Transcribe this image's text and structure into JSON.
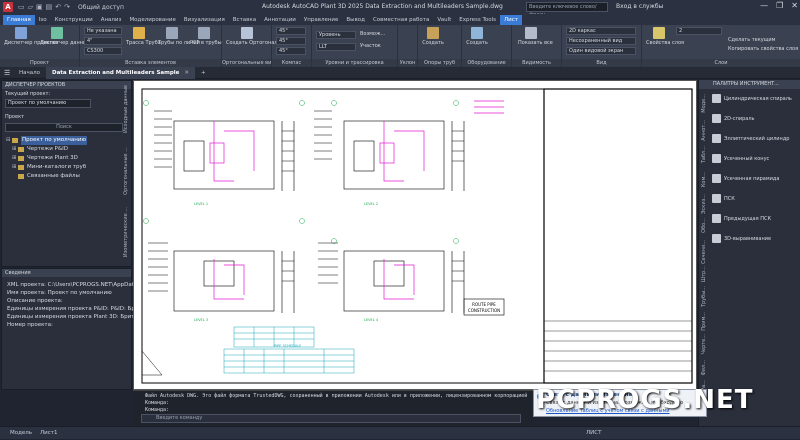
{
  "titlebar": {
    "app_icon": "A",
    "quick_access_icons": [
      "new-icon",
      "open-icon",
      "save-icon",
      "save-as-icon",
      "undo-icon",
      "redo-icon"
    ],
    "share": "Общий доступ",
    "title": "Autodesk AutoCAD Plant 3D 2025   Data Extraction and Multileaders Sample.dwg",
    "search_placeholder": "Введите ключевое слово/фразу",
    "signin": "Вход в службы",
    "window_buttons": [
      "—",
      "❐",
      "✕"
    ]
  },
  "ribbon_tabs": [
    "Главная",
    "Iso",
    "Конструкции",
    "Анализ",
    "Моделирование",
    "Визуализация",
    "Вставка",
    "Аннотации",
    "Управление",
    "Вывод",
    "Совместная работа",
    "Vault",
    "Express Tools",
    "Лист"
  ],
  "active_ribbon_tab": "Главная",
  "ribbon": {
    "panels": [
      {
        "label": "Проект",
        "buttons": [
          "Диспетчер проектов",
          "Диспетчер данных"
        ]
      },
      {
        "label": "Вставка элементов",
        "combo1": "Не указана",
        "combo2": "4\"",
        "combo3": "CS300",
        "buttons": [
          "Трасса Труба",
          "Трубы по линии",
          "PCF в трубы"
        ]
      },
      {
        "label": "Ортогональные виды",
        "buttons": [
          "Создать Ортогональный вид"
        ]
      },
      {
        "label": "Компас",
        "values": [
          "45°",
          "45°",
          "45°"
        ]
      },
      {
        "label": "Уровни и трассировка",
        "combo1": "Уровень",
        "combo2": "LLT",
        "checks": [
          "Возмож...",
          "Участок"
        ]
      },
      {
        "label": "Уклон",
        "buttons": [
          "Создать"
        ]
      },
      {
        "label": "Опоры труб",
        "buttons": [
          "Создать"
        ]
      },
      {
        "label": "Оборудование",
        "buttons": [
          "Показать все"
        ]
      },
      {
        "label": "Видимость",
        "combo1": "2D каркас",
        "combo2": "Несохраненный вид",
        "combo3": "Один видовой экран"
      },
      {
        "label": "Вид",
        "buttons": [
          "Свойства слоя"
        ]
      },
      {
        "label": "Слои",
        "combo1": "2",
        "buttons": [
          "Сделать текущим",
          "Копировать свойства слоя"
        ]
      }
    ]
  },
  "doc_tabs": [
    "Начало",
    "Data Extraction and Multileaders Sample"
  ],
  "active_doc_tab": "Data Extraction and Multileaders Sample",
  "project_manager": {
    "title": "ДИСПЕТЧЕР ПРОЕКТОВ",
    "current_label": "Текущий проект:",
    "current_value": "Проект по умолчанию",
    "section": "Проект",
    "search": "Поиск",
    "tree": [
      {
        "label": "Проект по умолчанию",
        "level": 0,
        "selected": true
      },
      {
        "label": "Чертежи P&ID",
        "level": 1
      },
      {
        "label": "Чертежи Plant 3D",
        "level": 1
      },
      {
        "label": "Мини-каталоги труб",
        "level": 1
      },
      {
        "label": "Связанные файлы",
        "level": 1
      }
    ],
    "side_tabs": [
      "Исходные данные",
      "Ортогональные ...",
      "Изометрические ..."
    ]
  },
  "details": {
    "title": "Сведения",
    "lines": [
      "XML проекта: C:\\Users\\PCPROGS.NET\\AppData",
      "Имя проекта: Проект по умолчанию",
      "Описание проекта:",
      "Единицы измерения проекта P&ID: P&ID: Брит",
      "Единицы измерения проекта Plant 3D: Брита",
      "Номер проекта:"
    ]
  },
  "palette": {
    "title": "ПАЛИТРЫ ИНСТРУМЕНТ...",
    "items": [
      "Цилиндрическая спираль",
      "2D-спираль",
      "Эллиптический цилиндр",
      "Усеченный конус",
      "Усеченная пирамида",
      "ПСК",
      "Предыдущая ПСК",
      "3D-выравнивание"
    ],
    "side_tabs": [
      "Моде...",
      "Аннот...",
      "Табл...",
      "Ком...",
      "Эскиз...",
      "Обо...",
      "Сечени...",
      "Штр...",
      "Трубы...",
      "Прим...",
      "Черте...",
      "Фил...",
      "Ра..."
    ]
  },
  "drawing": {
    "title_block_1": "ROUTE PIPE",
    "title_block_2": "CONSTRUCTION",
    "labels": [
      "LEVEL 1",
      "LEVEL 2",
      "LEVEL 3",
      "LEVEL 4"
    ],
    "table_title": "PIPE SCHEDULE"
  },
  "command": {
    "history": [
      "Файл Autodesk DWG. Это файл формата TrustedDWG, сохраненный в приложении Autodesk или в приложении, лицензированном корпорацией",
      "Команда:",
      "Команда:"
    ],
    "placeholder": "Введите команду"
  },
  "notification": {
    "title": "Связь с данными изменена",
    "body": "Связь с данными изменена. Возможно, необходимо",
    "link": "Обновление таблиц с учетом связи с данными"
  },
  "statusbar": {
    "layout_tabs": [
      "Модель",
      "Лист1"
    ],
    "left_text": "ЛИСТ"
  },
  "watermark": "PCPROGS.NET",
  "colors": {
    "accent": "#3a7bd5",
    "titlebar": "#2b3140",
    "ribbon": "#3a4150",
    "canvas": "#ffffff",
    "drawing_line": "#000000",
    "drawing_magenta": "#e11bd3",
    "drawing_green": "#18a74a"
  }
}
